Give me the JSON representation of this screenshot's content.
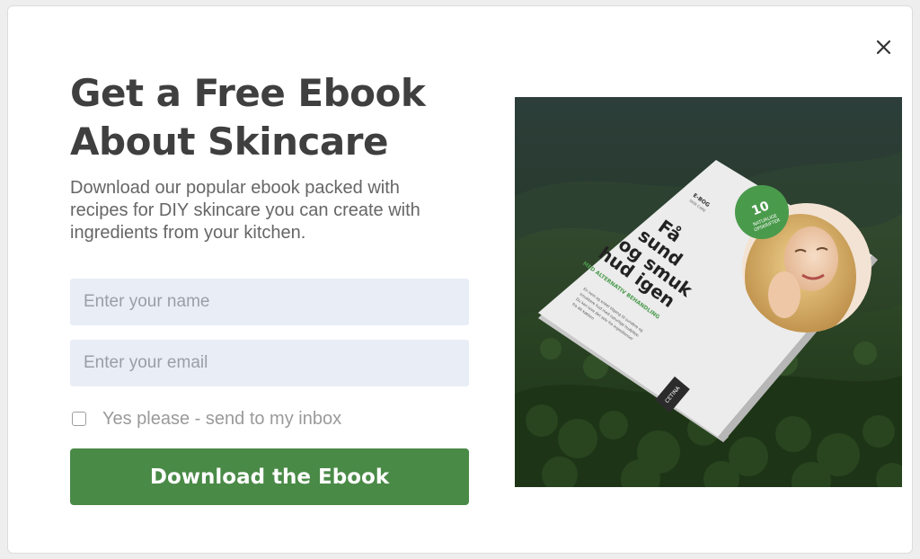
{
  "popup": {
    "title_line1": "Get a Free Ebook",
    "title_line2": "About Skincare",
    "description_lines": [
      "Download our popular ebook packed with",
      "recipes for DIY skincare you can create with",
      "ingredients from your kitchen."
    ],
    "name_placeholder": "Enter your name",
    "email_placeholder": "Enter your email",
    "consent_label": "Yes please - send to my inbox",
    "consent_checked": false,
    "cta_label": "Download the Ebook",
    "close_icon": "close-icon"
  },
  "book": {
    "badge_number": "10",
    "badge_text": [
      "NATURLIGE",
      "OPSKRIFTER"
    ],
    "top_label": [
      "E-BOG",
      "SKIN CARE"
    ],
    "title_lines": [
      "Få",
      "sund",
      "og smuk",
      "hud igen"
    ],
    "subtitle": "MED ALTERNATIV BEHANDLING",
    "body_lines": [
      "En nem og enkel tilgang til sundere og",
      "smukkere hud med naturlige hudpleje.",
      "Du kan lave det selv fra ingredienser",
      "fra dit køkken"
    ],
    "brand": "CETINA"
  },
  "colors": {
    "accent": "#4a8a47",
    "title": "#3f3f3f",
    "text": "#666666",
    "field_bg": "#e8edf6",
    "placeholder": "#9a9ea8"
  }
}
